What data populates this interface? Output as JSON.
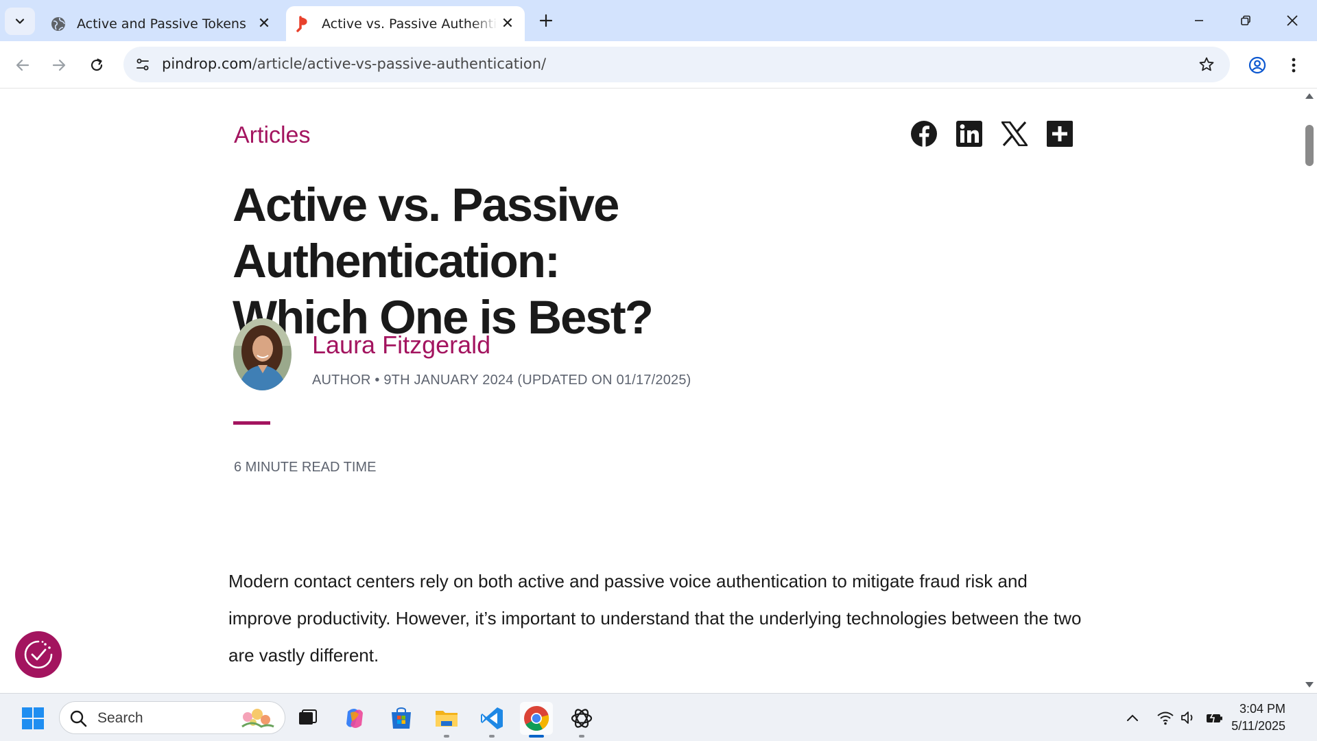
{
  "browser": {
    "tabs": [
      {
        "title": "Active and Passive Tokens",
        "favicon": "globe-icon",
        "active": false
      },
      {
        "title": "Active vs. Passive Authentication",
        "favicon": "pindrop-logo-icon",
        "active": true
      }
    ],
    "url_domain": "pindrop.com",
    "url_path": "/article/active-vs-passive-authentication/"
  },
  "article": {
    "category": "Articles",
    "headline_line1": "Active vs. Passive Authentication:",
    "headline_line2": "Which One is Best?",
    "author_name": "Laura Fitzgerald",
    "author_meta": "AUTHOR • 9TH JANUARY 2024 (UPDATED ON 01/17/2025)",
    "read_time": "6 MINUTE READ TIME",
    "body_paragraph": "Modern contact centers rely on both active and passive voice authentication to mitigate fraud risk and improve productivity. However, it’s important to understand that the underlying technologies between the two are vastly different.",
    "share_icons": [
      "facebook-icon",
      "linkedin-icon",
      "x-icon",
      "add-share-icon"
    ]
  },
  "taskbar": {
    "search_placeholder": "Search",
    "apps": [
      "start-icon",
      "task-view-icon",
      "copilot-icon",
      "store-icon",
      "file-explorer-icon",
      "vscode-icon",
      "chrome-icon",
      "chatgpt-icon"
    ],
    "time": "3:04 PM",
    "date": "5/11/2025"
  },
  "colors": {
    "brand": "#a3145f",
    "tabstrip": "#d3e3fd",
    "omnibox": "#edf2fa"
  }
}
